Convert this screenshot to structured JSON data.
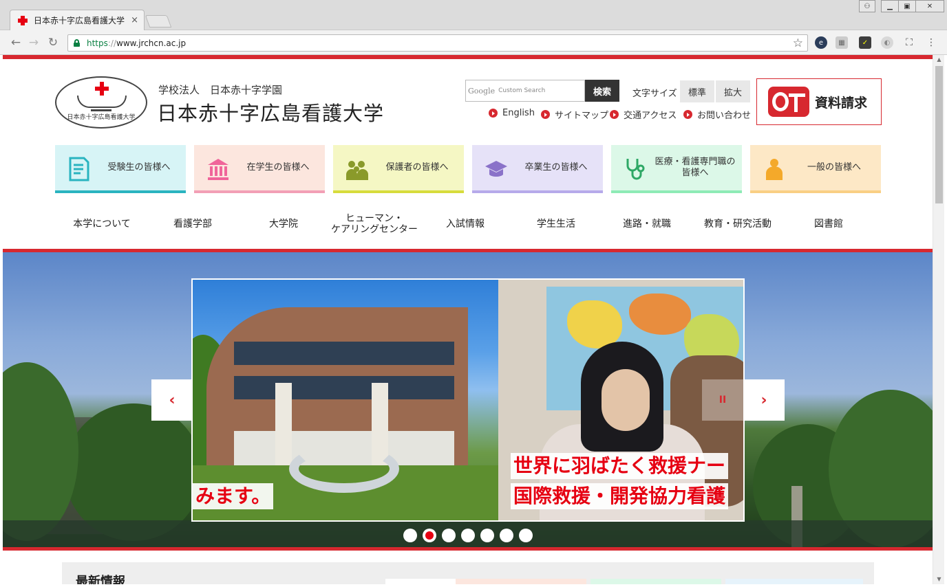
{
  "browser": {
    "tab_title": "日本赤十字広島看護大学",
    "tab_close": "×",
    "url_scheme": "https",
    "url_sep": "://",
    "url_host": "www.jrchcn.ac.jp"
  },
  "header": {
    "org_name": "学校法人　日本赤十字学園",
    "univ_name": "日本赤十字広島看護大学",
    "logo_text": "日本赤十字広島看護大学",
    "search_placeholder": "Custom Search",
    "search_brand": "Google",
    "search_button": "検索",
    "fontsize_label": "文字サイズ",
    "fontsize_standard": "標準",
    "fontsize_large": "拡大",
    "request_label": "資料請求",
    "util_links": [
      "English",
      "サイトマップ",
      "交通アクセス",
      "お問い合わせ"
    ]
  },
  "audience": [
    {
      "label": "受験生の皆様へ",
      "color": "#d7f4f6",
      "bar": "#2ab4c0",
      "icon": "document-icon"
    },
    {
      "label": "在学生の皆様へ",
      "color": "#fce6de",
      "bar": "#f29fb6",
      "icon": "building-icon"
    },
    {
      "label": "保護者の皆様へ",
      "color": "#f5f7c4",
      "bar": "#d7dc3c",
      "icon": "family-icon"
    },
    {
      "label": "卒業生の皆様へ",
      "color": "#e6e2f8",
      "bar": "#b6aaea",
      "icon": "graduation-cap-icon"
    },
    {
      "label": "医療・看護専門職の皆様へ",
      "color": "#dcf8e8",
      "bar": "#8eebb6",
      "icon": "stethoscope-icon"
    },
    {
      "label": "一般の皆様へ",
      "color": "#fde8c6",
      "bar": "#f9cf84",
      "icon": "person-icon"
    }
  ],
  "nav": [
    "本学について",
    "看護学部",
    "大学院",
    "ヒューマン・\nケアリングセンター",
    "入試情報",
    "学生生活",
    "進路・就職",
    "教育・研究活動",
    "図書館"
  ],
  "hero": {
    "caption_left": "みます。",
    "caption_right_1": "世界に羽ばたく救援ナー",
    "caption_right_2": "国際救援・開発協力看護",
    "prev": "‹",
    "next": "›",
    "pause": "II",
    "dot_count": 7,
    "active_dot": 1
  },
  "news": {
    "title": "最新情報"
  },
  "colors": {
    "accent_red": "#d7282f",
    "cross_red": "#e60012"
  }
}
